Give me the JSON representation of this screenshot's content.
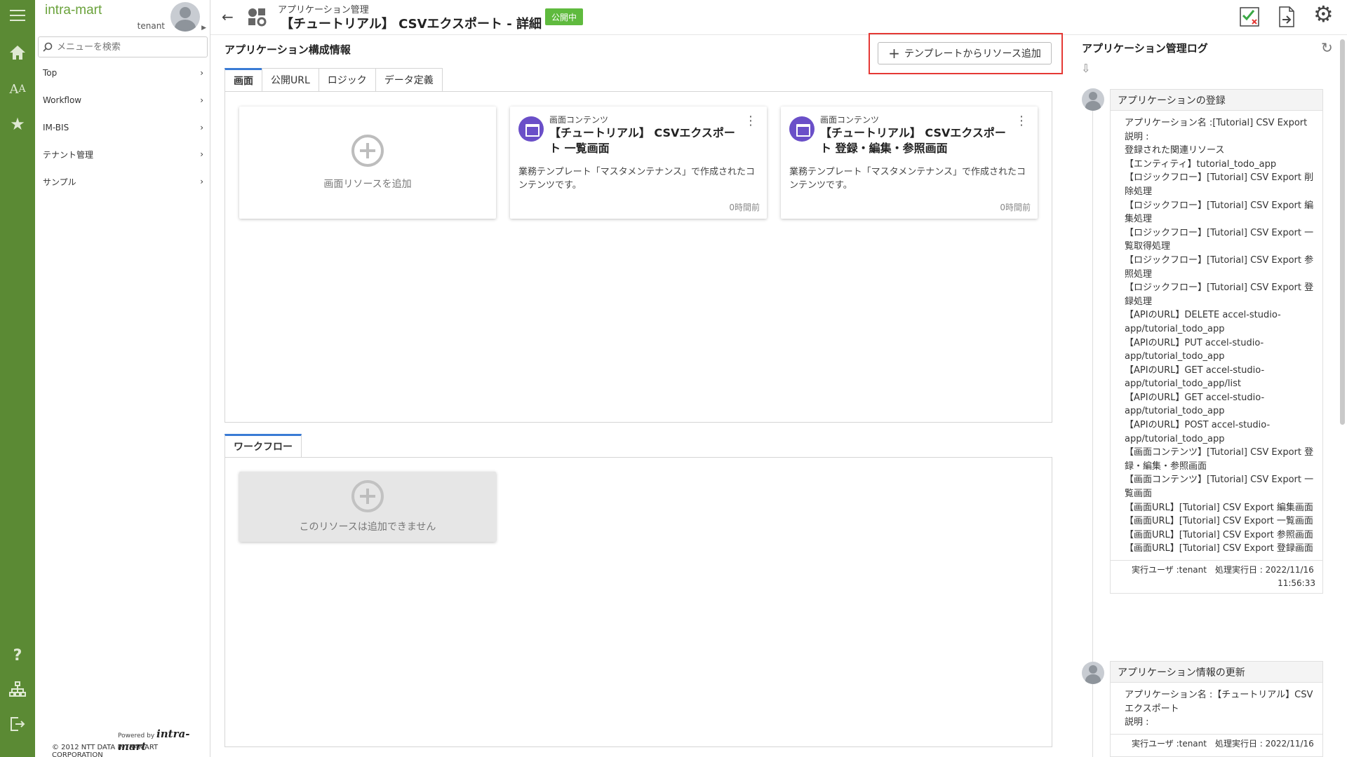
{
  "sidebar": {
    "brand": "intra-mart",
    "user": "tenant",
    "search_placeholder": "メニューを検索",
    "items": [
      {
        "label": "Top"
      },
      {
        "label": "Workflow"
      },
      {
        "label": "IM-BIS"
      },
      {
        "label": "テナント管理"
      },
      {
        "label": "サンプル"
      }
    ],
    "powered_by": "Powered by",
    "powered_brand": "intra-mart",
    "copyright": "© 2012 NTT DATA INTRAMART CORPORATION"
  },
  "rail_icons": [
    "menu-icon",
    "home-icon",
    "font-size-icon",
    "star-icon",
    "help-icon",
    "sitemap-icon",
    "logout-icon"
  ],
  "header": {
    "breadcrumb": "アプリケーション管理",
    "title": "【チュートリアル】 CSVエクスポート - 詳細",
    "status_badge": "公開中",
    "badge_color": "#5fba3e",
    "icons": [
      "checklist-icon",
      "export-file-icon",
      "gear-icon"
    ]
  },
  "main": {
    "section_title": "アプリケーション構成情報",
    "add_template_label": "テンプレートからリソース追加",
    "tabs": [
      {
        "label": "画面",
        "active": true
      },
      {
        "label": "公開URL"
      },
      {
        "label": "ロジック"
      },
      {
        "label": "データ定義"
      }
    ],
    "add_screen_label": "画面リソースを追加",
    "cards": [
      {
        "type": "画面コンテンツ",
        "title": "【チュートリアル】 CSVエクスポート 一覧画面",
        "description": "業務テンプレート「マスタメンテナンス」で作成されたコンテンツです。",
        "time": "0時間前"
      },
      {
        "type": "画面コンテンツ",
        "title": "【チュートリアル】 CSVエクスポート 登録・編集・参照画面",
        "description": "業務テンプレート「マスタメンテナンス」で作成されたコンテンツです。",
        "time": "0時間前"
      }
    ],
    "workflow_tab": "ワークフロー",
    "workflow_disabled_label": "このリソースは追加できません"
  },
  "log": {
    "title": "アプリケーション管理ログ",
    "entries": [
      {
        "heading": "アプリケーションの登録",
        "lines": [
          "アプリケーション名 :[Tutorial] CSV Export",
          "説明 :",
          "登録された関連リソース",
          "【エンティティ】tutorial_todo_app",
          "【ロジックフロー】[Tutorial] CSV Export 削除処理",
          "【ロジックフロー】[Tutorial] CSV Export 編集処理",
          "【ロジックフロー】[Tutorial] CSV Export 一覧取得処理",
          "【ロジックフロー】[Tutorial] CSV Export 参照処理",
          "【ロジックフロー】[Tutorial] CSV Export 登録処理",
          "【APIのURL】DELETE accel-studio-app/tutorial_todo_app",
          "【APIのURL】PUT accel-studio-app/tutorial_todo_app",
          "【APIのURL】GET accel-studio-app/tutorial_todo_app/list",
          "【APIのURL】GET accel-studio-app/tutorial_todo_app",
          "【APIのURL】POST accel-studio-app/tutorial_todo_app",
          "【画面コンテンツ】[Tutorial] CSV Export 登録・編集・参照画面",
          "【画面コンテンツ】[Tutorial] CSV Export 一覧画面",
          "【画面URL】[Tutorial] CSV Export 編集画面",
          "【画面URL】[Tutorial] CSV Export 一覧画面",
          "【画面URL】[Tutorial] CSV Export 参照画面",
          "【画面URL】[Tutorial] CSV Export 登録画面"
        ],
        "footer": "実行ユーザ :tenant　処理実行日 : 2022/11/16",
        "footer_time": "11:56:33"
      },
      {
        "heading": "アプリケーション情報の更新",
        "lines": [
          "アプリケーション名 :【チュートリアル】CSVエクスポート",
          "説明 :"
        ],
        "footer": "実行ユーザ :tenant　処理実行日 : 2022/11/16",
        "footer_time": ""
      }
    ]
  }
}
